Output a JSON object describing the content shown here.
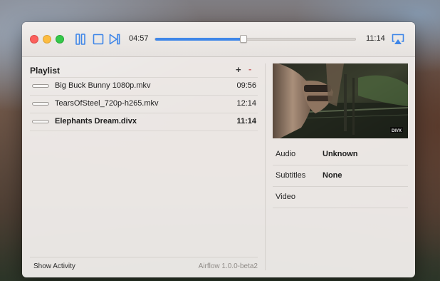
{
  "player": {
    "elapsed": "04:57",
    "total": "11:14",
    "progress": 0.44
  },
  "playlist": {
    "title": "Playlist",
    "add_label": "+",
    "remove_label": "-",
    "items": [
      {
        "name": "Big Buck Bunny 1080p.mkv",
        "duration": "09:56",
        "active": false,
        "watched": 0.0
      },
      {
        "name": "TearsOfSteel_720p-h265.mkv",
        "duration": "12:14",
        "active": false,
        "watched": 0.0
      },
      {
        "name": "Elephants Dream.divx",
        "duration": "11:14",
        "active": true,
        "watched": 0.44
      }
    ]
  },
  "footer": {
    "show_activity": "Show Activity",
    "version": "Airflow 1.0.0-beta2"
  },
  "info": {
    "rows": [
      {
        "key": "Audio",
        "value": "Unknown"
      },
      {
        "key": "Subtitles",
        "value": "None"
      },
      {
        "key": "Video",
        "value": ""
      }
    ]
  },
  "preview": {
    "watermark": "DIVX"
  },
  "colors": {
    "accent": "#3f86e8",
    "close": "#fc605c",
    "minimize": "#fdbc40",
    "zoom": "#34c84a",
    "remove": "#c96a6a"
  },
  "icons": {
    "pause": "pause-icon",
    "stop": "stop-icon",
    "next": "skip-next-icon",
    "airplay": "airplay-icon"
  }
}
